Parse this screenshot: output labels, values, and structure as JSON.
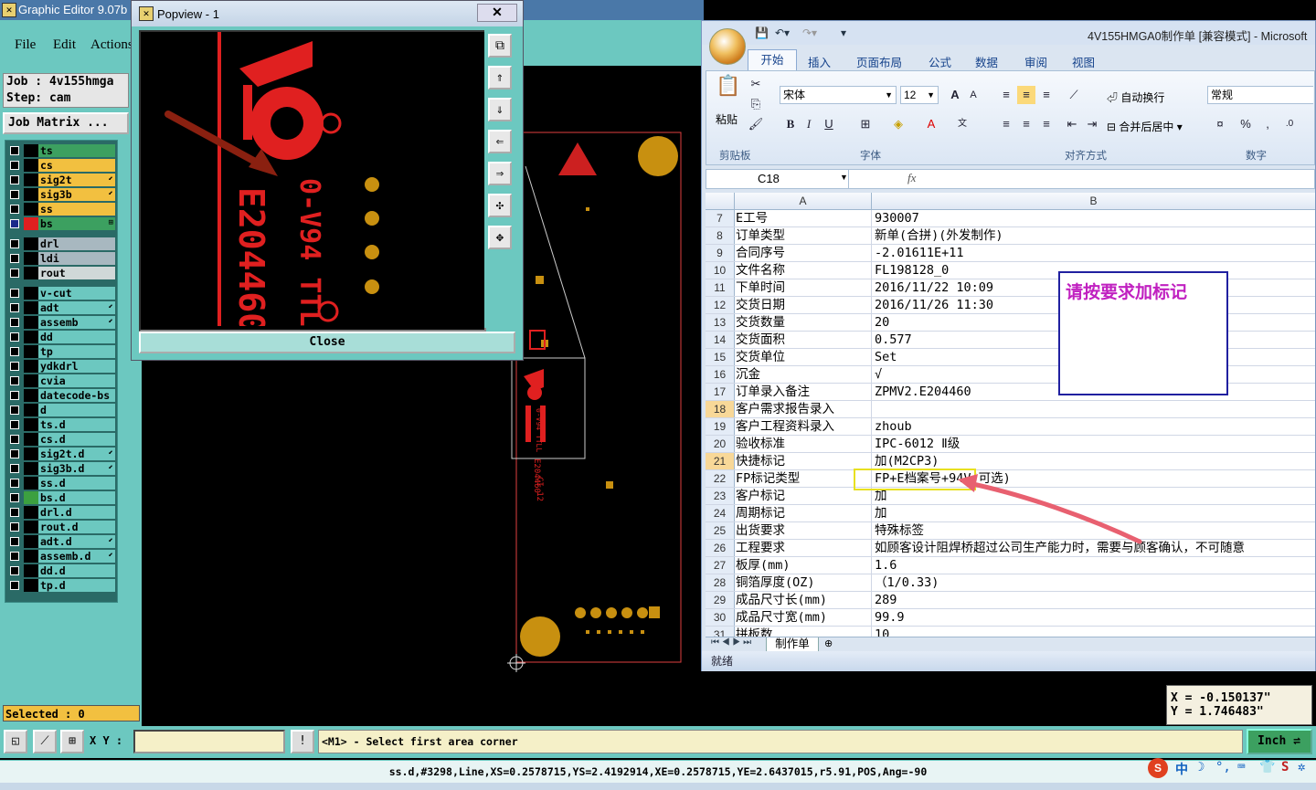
{
  "editor": {
    "title": "Graphic Editor 9.07b",
    "menus": [
      "File",
      "Edit",
      "Actions"
    ],
    "job_line": "Job : 4v155hmga",
    "step_line": "Step: cam",
    "job_matrix": "Job Matrix ...",
    "layers": [
      {
        "name": "ts",
        "color": "#3ca060"
      },
      {
        "name": "cs",
        "color": "#f2c040"
      },
      {
        "name": "sig2t",
        "color": "#f2c040",
        "arrow": "⬋"
      },
      {
        "name": "sig3b",
        "color": "#f2c040",
        "arrow": "⬋"
      },
      {
        "name": "ss",
        "color": "#f2c040"
      },
      {
        "name": "bs",
        "color": "#3ca060",
        "active": true,
        "arrow": "⊞"
      },
      {
        "name": "drl",
        "color": "#a8b8c0"
      },
      {
        "name": "ldi",
        "color": "#a8b8c0"
      },
      {
        "name": "rout",
        "color": "#d0d8d8"
      },
      {
        "name": "v-cut",
        "color": "#6cc8c0"
      },
      {
        "name": "adt",
        "color": "#6cc8c0",
        "arrow": "⬋"
      },
      {
        "name": "assemb",
        "color": "#6cc8c0",
        "arrow": "⬋"
      },
      {
        "name": "dd",
        "color": "#6cc8c0"
      },
      {
        "name": "tp",
        "color": "#6cc8c0"
      },
      {
        "name": "ydkdrl",
        "color": "#6cc8c0"
      },
      {
        "name": "cvia",
        "color": "#6cc8c0"
      },
      {
        "name": "datecode-bs",
        "color": "#6cc8c0"
      },
      {
        "name": "d",
        "color": "#6cc8c0"
      },
      {
        "name": "ts.d",
        "color": "#6cc8c0"
      },
      {
        "name": "cs.d",
        "color": "#6cc8c0"
      },
      {
        "name": "sig2t.d",
        "color": "#6cc8c0",
        "arrow": "⬋"
      },
      {
        "name": "sig3b.d",
        "color": "#6cc8c0",
        "arrow": "⬋"
      },
      {
        "name": "ss.d",
        "color": "#6cc8c0"
      },
      {
        "name": "bs.d",
        "color": "#6cc8c0",
        "swatch": "#3ca040"
      },
      {
        "name": "drl.d",
        "color": "#6cc8c0"
      },
      {
        "name": "rout.d",
        "color": "#6cc8c0"
      },
      {
        "name": "adt.d",
        "color": "#6cc8c0",
        "arrow": "⬋"
      },
      {
        "name": "assemb.d",
        "color": "#6cc8c0",
        "arrow": "⬋"
      },
      {
        "name": "dd.d",
        "color": "#6cc8c0"
      },
      {
        "name": "tp.d",
        "color": "#6cc8c0"
      }
    ],
    "selected": "Selected : 0",
    "xy_label": "X Y :",
    "prompt": "<M1> - Select first area corner",
    "units_button": "Inch",
    "status_line": "ss.d,#3298,Line,XS=0.2578715,YS=2.4192914,XE=0.2578715,YE=2.6437015,r5.91,POS,Ang=-90",
    "coord_x": "X = -0.150137\"",
    "coord_y": "Y = 1.746483\""
  },
  "popview": {
    "title": "Popview - 1",
    "close_label": "Close",
    "close_x": "✕"
  },
  "excel": {
    "title": "4V155HMGA0制作单 [兼容模式] - Microsoft",
    "tabs": [
      "开始",
      "插入",
      "页面布局",
      "公式",
      "数据",
      "审阅",
      "视图"
    ],
    "paste_label": "粘贴",
    "font_name": "宋体",
    "font_size": "12",
    "wrap_text": "自动换行",
    "merge_center": "合并后居中",
    "number_format": "常规",
    "group_labels": [
      "剪贴板",
      "字体",
      "对齐方式",
      "数字"
    ],
    "name_box": "C18",
    "fx": "fx",
    "col_a": "A",
    "col_b": "B",
    "rows": [
      {
        "n": "7",
        "a": "E工号",
        "b": "930007"
      },
      {
        "n": "8",
        "a": "订单类型",
        "b": "新单(合拼)(外发制作)"
      },
      {
        "n": "9",
        "a": "合同序号",
        "b": "-2.01611E+11"
      },
      {
        "n": "10",
        "a": "文件名称",
        "b": "FL198128_0"
      },
      {
        "n": "11",
        "a": "下单时间",
        "b": "2016/11/22 10:09"
      },
      {
        "n": "12",
        "a": "交货日期",
        "b": "2016/11/26 11:30"
      },
      {
        "n": "13",
        "a": "交货数量",
        "b": "20"
      },
      {
        "n": "14",
        "a": "交货面积",
        "b": "0.577"
      },
      {
        "n": "15",
        "a": "交货单位",
        "b": "Set"
      },
      {
        "n": "16",
        "a": "沉金",
        "b": "√"
      },
      {
        "n": "17",
        "a": "订单录入备注",
        "b": "ZPMV2.E204460"
      },
      {
        "n": "18",
        "a": "客户需求报告录入",
        "b": "",
        "hl": true
      },
      {
        "n": "19",
        "a": "客户工程资料录入",
        "b": "zhoub"
      },
      {
        "n": "20",
        "a": "验收标准",
        "b": "IPC-6012 Ⅱ级"
      },
      {
        "n": "21",
        "a": "快捷标记",
        "b": "加(M2CP3)",
        "hl": true
      },
      {
        "n": "22",
        "a": "FP标记类型",
        "b": "FP+E档案号+94V(可选)"
      },
      {
        "n": "23",
        "a": "客户标记",
        "b": "加"
      },
      {
        "n": "24",
        "a": "周期标记",
        "b": "加"
      },
      {
        "n": "25",
        "a": "出货要求",
        "b": "特殊标签"
      },
      {
        "n": "26",
        "a": "工程要求",
        "b": "如顾客设计阻焊桥超过公司生产能力时，需要与顾客确认，不可随意"
      },
      {
        "n": "27",
        "a": "板厚(mm)",
        "b": "1.6"
      },
      {
        "n": "28",
        "a": "铜箔厚度(OZ)",
        "b": "（1/0.33)"
      },
      {
        "n": "29",
        "a": "成品尺寸长(mm)",
        "b": "289"
      },
      {
        "n": "30",
        "a": "成品尺寸宽(mm)",
        "b": "99.9"
      },
      {
        "n": "31",
        "a": "拼板数",
        "b": "10"
      }
    ],
    "callout_text": "请按要求加标记",
    "sheet_tab": "制作单",
    "status": "就绪"
  },
  "pcb_text": {
    "board_code": "E204460",
    "marking": "0-V94 TTLL",
    "small_code": "E204460",
    "side_label": "CI 12"
  },
  "ime": {
    "label": "中"
  }
}
